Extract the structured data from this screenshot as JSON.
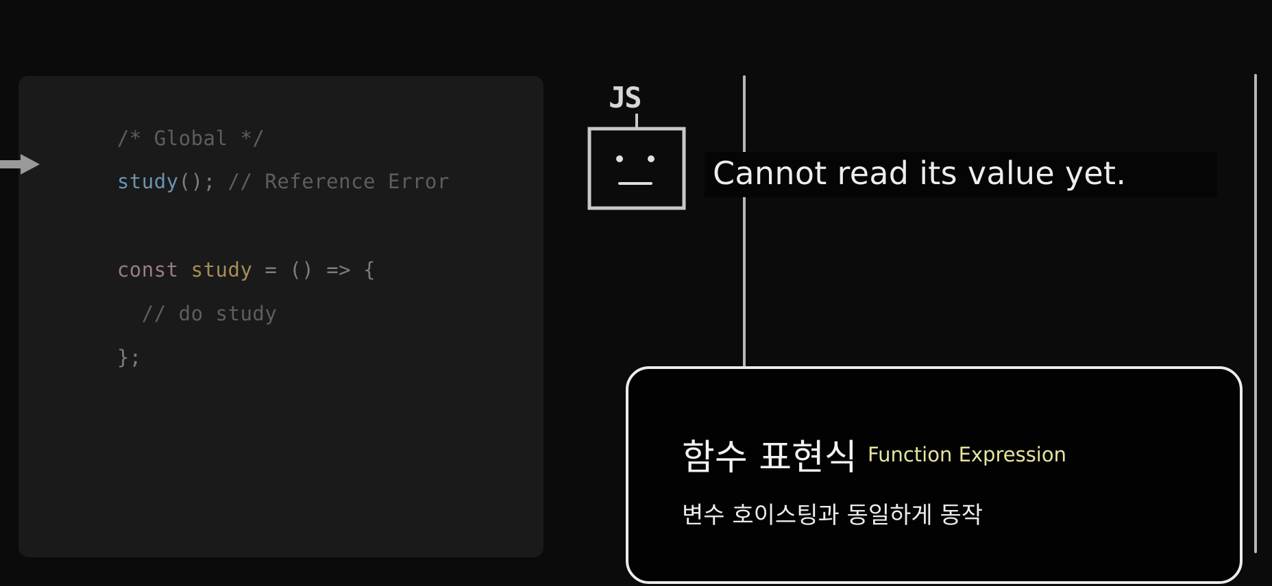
{
  "code": {
    "line1": "/* Global */",
    "line2_call": "study",
    "line2_punct": "();",
    "line2_comment": " // Reference Error",
    "line3_keyword": "const",
    "line3_name": "study",
    "line3_rest": " = () => {",
    "line4": "  // do study",
    "line5": "};"
  },
  "robot": {
    "label": "JS",
    "icon": "robot-icon"
  },
  "speech": {
    "text": "Cannot read its value yet."
  },
  "card": {
    "title": "함수 표현식",
    "subtitle": "Function Expression",
    "description": "변수 호이스팅과 동일하게 동작"
  },
  "colors": {
    "background": "#0b0b0b",
    "panel": "#1a1a1a",
    "call": "#6a93b0",
    "keyword": "#9c7a88",
    "name": "#a88d58",
    "subtitle": "#e8e4a0"
  }
}
